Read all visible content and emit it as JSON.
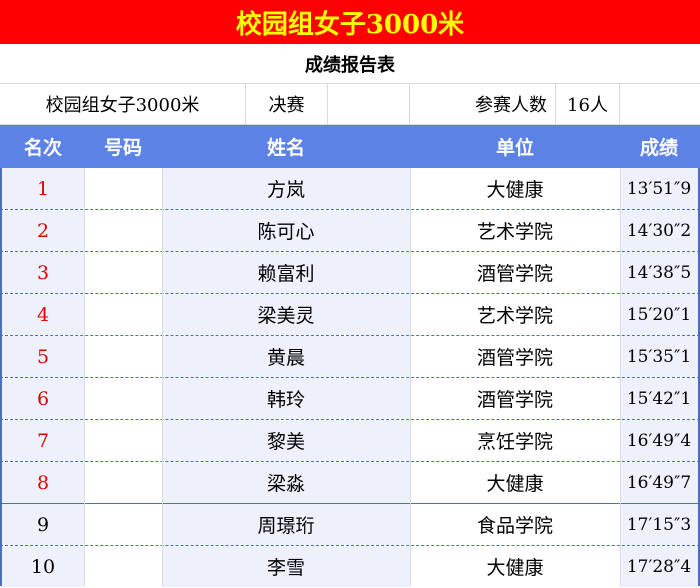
{
  "title": "校园组女子3000米",
  "subtitle": "成绩报告表",
  "info": {
    "event": "校园组女子3000米",
    "round": "决赛",
    "participants_label": "参赛人数",
    "participants_value": "16人"
  },
  "headers": {
    "rank": "名次",
    "number": "号码",
    "name": "姓名",
    "unit": "单位",
    "score": "成绩"
  },
  "rows": [
    {
      "rank": "1",
      "number": "",
      "name": "方岚",
      "unit": "大健康",
      "score": "13′51″9"
    },
    {
      "rank": "2",
      "number": "",
      "name": "陈可心",
      "unit": "艺术学院",
      "score": "14′30″2"
    },
    {
      "rank": "3",
      "number": "",
      "name": "赖富利",
      "unit": "酒管学院",
      "score": "14′38″5"
    },
    {
      "rank": "4",
      "number": "",
      "name": "梁美灵",
      "unit": "艺术学院",
      "score": "15′20″1"
    },
    {
      "rank": "5",
      "number": "",
      "name": "黄晨",
      "unit": "酒管学院",
      "score": "15′35″1"
    },
    {
      "rank": "6",
      "number": "",
      "name": "韩玲",
      "unit": "酒管学院",
      "score": "15′42″1"
    },
    {
      "rank": "7",
      "number": "",
      "name": "黎美",
      "unit": "烹饪学院",
      "score": "16′49″4"
    },
    {
      "rank": "8",
      "number": "",
      "name": "梁淼",
      "unit": "大健康",
      "score": "16′49″7"
    },
    {
      "rank": "9",
      "number": "",
      "name": "周璟珩",
      "unit": "食品学院",
      "score": "17′15″3"
    },
    {
      "rank": "10",
      "number": "",
      "name": "李雪",
      "unit": "大健康",
      "score": "17′28″4"
    }
  ],
  "colors": {
    "title_bg": "#ff0000",
    "title_text": "#ffff00",
    "header_bg": "#5b82e4",
    "medal_rank_text": "#e00000"
  }
}
